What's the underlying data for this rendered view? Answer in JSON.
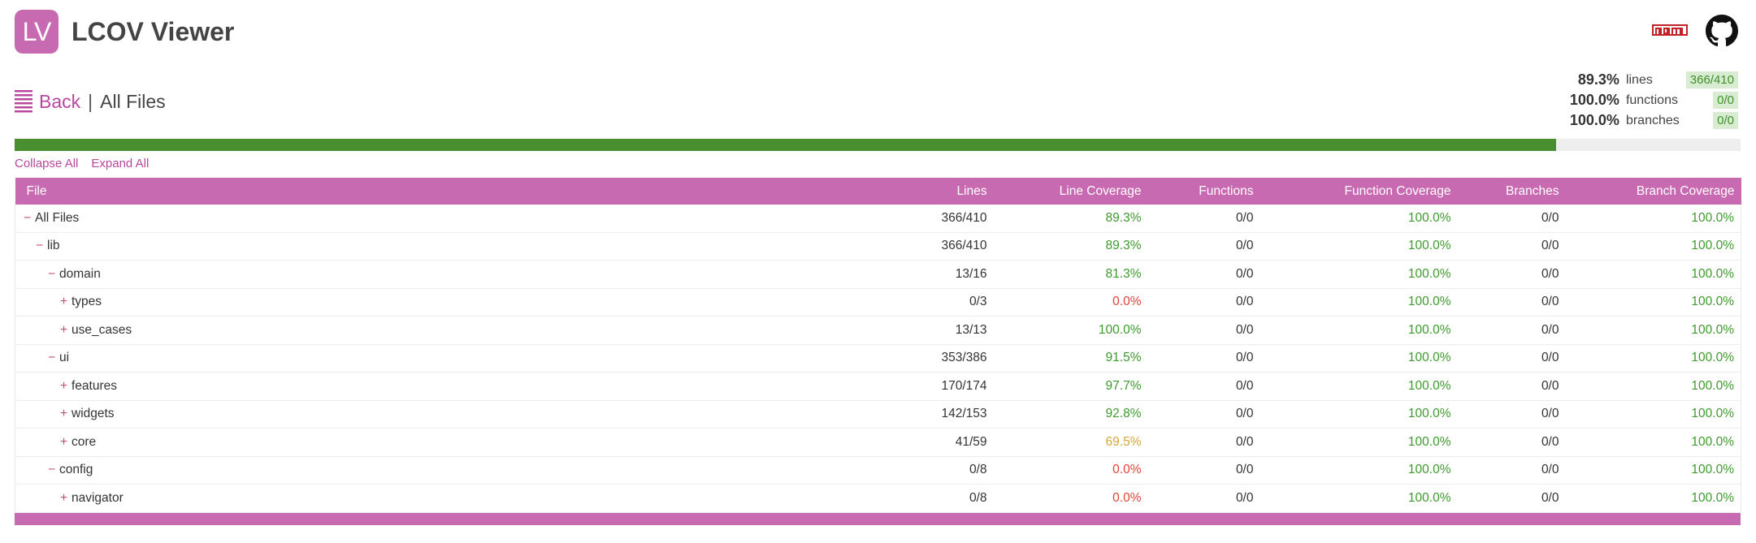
{
  "app": {
    "logo_text": "LV",
    "title": "LCOV Viewer",
    "icons": [
      "npm-icon",
      "github-icon"
    ]
  },
  "breadcrumb": {
    "back_label": "Back",
    "separator": "|",
    "current": "All Files"
  },
  "summary": {
    "lines": {
      "pct": "89.3%",
      "label": "lines",
      "count": "366/410"
    },
    "functions": {
      "pct": "100.0%",
      "label": "functions",
      "count": "0/0"
    },
    "branches": {
      "pct": "100.0%",
      "label": "branches",
      "count": "0/0"
    }
  },
  "progress": {
    "value": 0.893
  },
  "tree_actions": {
    "collapse_all": "Collapse All",
    "expand_all": "Expand All"
  },
  "table": {
    "headers": {
      "file": "File",
      "lines": "Lines",
      "line_coverage": "Line Coverage",
      "functions": "Functions",
      "function_coverage": "Function Coverage",
      "branches": "Branches",
      "branch_coverage": "Branch Coverage"
    },
    "rows": [
      {
        "toggle": "−",
        "depth": 0,
        "name": "All Files",
        "lines": "366/410",
        "line_cov": "89.3%",
        "line_status": "good",
        "functions": "0/0",
        "func_cov": "100.0%",
        "branches": "0/0",
        "branch_cov": "100.0%"
      },
      {
        "toggle": "−",
        "depth": 1,
        "name": "lib",
        "lines": "366/410",
        "line_cov": "89.3%",
        "line_status": "good",
        "functions": "0/0",
        "func_cov": "100.0%",
        "branches": "0/0",
        "branch_cov": "100.0%"
      },
      {
        "toggle": "−",
        "depth": 2,
        "name": "domain",
        "lines": "13/16",
        "line_cov": "81.3%",
        "line_status": "good",
        "functions": "0/0",
        "func_cov": "100.0%",
        "branches": "0/0",
        "branch_cov": "100.0%"
      },
      {
        "toggle": "+",
        "depth": 3,
        "name": "types",
        "lines": "0/3",
        "line_cov": "0.0%",
        "line_status": "bad",
        "functions": "0/0",
        "func_cov": "100.0%",
        "branches": "0/0",
        "branch_cov": "100.0%"
      },
      {
        "toggle": "+",
        "depth": 3,
        "name": "use_cases",
        "lines": "13/13",
        "line_cov": "100.0%",
        "line_status": "good",
        "functions": "0/0",
        "func_cov": "100.0%",
        "branches": "0/0",
        "branch_cov": "100.0%"
      },
      {
        "toggle": "−",
        "depth": 2,
        "name": "ui",
        "lines": "353/386",
        "line_cov": "91.5%",
        "line_status": "good",
        "functions": "0/0",
        "func_cov": "100.0%",
        "branches": "0/0",
        "branch_cov": "100.0%"
      },
      {
        "toggle": "+",
        "depth": 3,
        "name": "features",
        "lines": "170/174",
        "line_cov": "97.7%",
        "line_status": "good",
        "functions": "0/0",
        "func_cov": "100.0%",
        "branches": "0/0",
        "branch_cov": "100.0%"
      },
      {
        "toggle": "+",
        "depth": 3,
        "name": "widgets",
        "lines": "142/153",
        "line_cov": "92.8%",
        "line_status": "good",
        "functions": "0/0",
        "func_cov": "100.0%",
        "branches": "0/0",
        "branch_cov": "100.0%"
      },
      {
        "toggle": "+",
        "depth": 3,
        "name": "core",
        "lines": "41/59",
        "line_cov": "69.5%",
        "line_status": "warn",
        "functions": "0/0",
        "func_cov": "100.0%",
        "branches": "0/0",
        "branch_cov": "100.0%"
      },
      {
        "toggle": "−",
        "depth": 2,
        "name": "config",
        "lines": "0/8",
        "line_cov": "0.0%",
        "line_status": "bad",
        "functions": "0/0",
        "func_cov": "100.0%",
        "branches": "0/0",
        "branch_cov": "100.0%"
      },
      {
        "toggle": "+",
        "depth": 3,
        "name": "navigator",
        "lines": "0/8",
        "line_cov": "0.0%",
        "line_status": "bad",
        "functions": "0/0",
        "func_cov": "100.0%",
        "branches": "0/0",
        "branch_cov": "100.0%"
      }
    ]
  },
  "colors": {
    "accent": "#c86ab1",
    "link": "#b9479e",
    "good": "#3f9a2e",
    "bad": "#e0443a",
    "warn": "#d8a83a",
    "progress": "#4a8f2f"
  }
}
